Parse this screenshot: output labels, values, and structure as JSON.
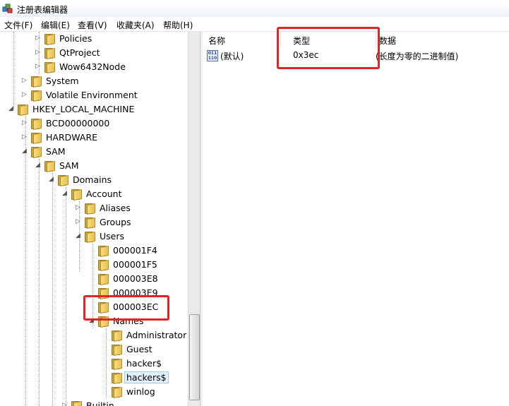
{
  "window": {
    "title": "注册表编辑器"
  },
  "menu": [
    "文件(F)",
    "编辑(E)",
    "查看(V)",
    "收藏夹(A)",
    "帮助(H)"
  ],
  "tree": [
    {
      "label": "Policies",
      "expander": "▷"
    },
    {
      "label": "QtProject",
      "expander": "▷"
    },
    {
      "label": "Wow6432Node",
      "expander": "▷"
    },
    {
      "label": "System",
      "expander": "▷"
    },
    {
      "label": "Volatile Environment",
      "expander": "▷"
    },
    {
      "label": "HKEY_LOCAL_MACHINE",
      "expander": "◢"
    },
    {
      "label": "BCD00000000",
      "expander": "▷"
    },
    {
      "label": "HARDWARE",
      "expander": "▷"
    },
    {
      "label": "SAM",
      "expander": "◢"
    },
    {
      "label": "SAM",
      "expander": "◢"
    },
    {
      "label": "Domains",
      "expander": "◢"
    },
    {
      "label": "Account",
      "expander": "◢"
    },
    {
      "label": "Aliases",
      "expander": "▷"
    },
    {
      "label": "Groups",
      "expander": "▷"
    },
    {
      "label": "Users",
      "expander": "◢"
    },
    {
      "label": "000001F4",
      "expander": ""
    },
    {
      "label": "000001F5",
      "expander": ""
    },
    {
      "label": "000003E8",
      "expander": ""
    },
    {
      "label": "000003E9",
      "expander": ""
    },
    {
      "label": "000003EC",
      "expander": ""
    },
    {
      "label": "Names",
      "expander": "◢"
    },
    {
      "label": "Administrator",
      "expander": ""
    },
    {
      "label": "Guest",
      "expander": ""
    },
    {
      "label": "hacker$",
      "expander": ""
    },
    {
      "label": "hackers$",
      "expander": "",
      "selected": true
    },
    {
      "label": "winlog",
      "expander": ""
    },
    {
      "label": "Builtin",
      "expander": "▷"
    }
  ],
  "list": {
    "headers": {
      "name": "名称",
      "type": "类型",
      "data": "数据"
    },
    "rows": [
      {
        "name": "(默认)",
        "type": "0x3ec",
        "data": "(长度为零的二进制值)",
        "icon": "binary-value-icon"
      }
    ]
  },
  "annotations": {
    "color": "#e02525"
  }
}
